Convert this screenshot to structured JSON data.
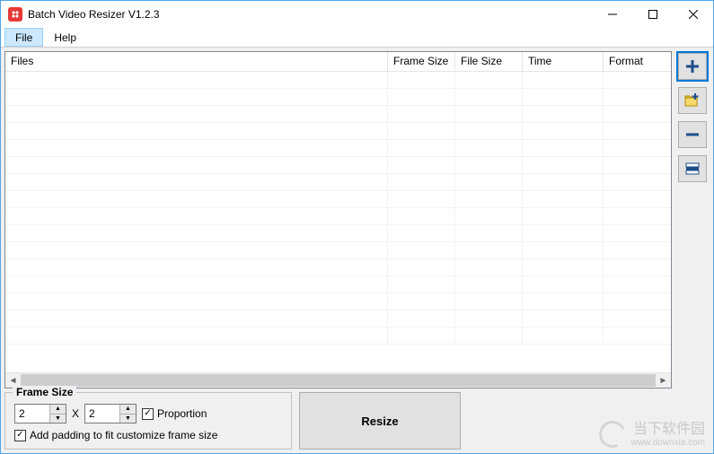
{
  "titlebar": {
    "title": "Batch Video Resizer V1.2.3"
  },
  "menu": {
    "file": "File",
    "help": "Help"
  },
  "table": {
    "headers": {
      "files": "Files",
      "frame_size": "Frame Size",
      "file_size": "File Size",
      "time": "Time",
      "format": "Format"
    },
    "rows": []
  },
  "frame_size_group": {
    "legend": "Frame Size",
    "width": "2",
    "height": "2",
    "x": "X",
    "proportion": "Proportion",
    "padding": "Add padding to fit customize frame size"
  },
  "resize_btn": "Resize",
  "sidebar": {
    "add_file": "add-file",
    "add_folder": "add-folder",
    "remove": "remove",
    "remove_all": "remove-all"
  },
  "watermark": {
    "name": "当下软件园",
    "url": "www.downxia.com"
  }
}
